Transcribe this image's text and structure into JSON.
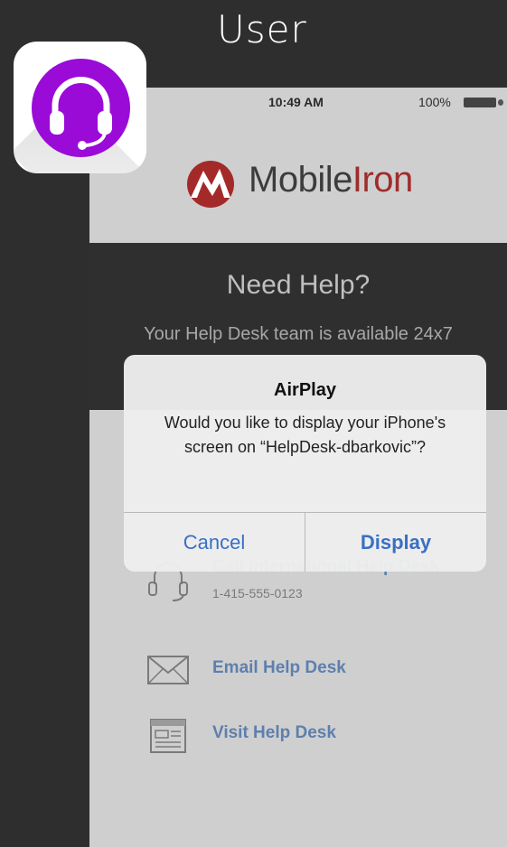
{
  "header": {
    "title": "User"
  },
  "app_icon": {
    "icon": "headset-icon",
    "color": "#9a0bd8"
  },
  "phone": {
    "status_bar": {
      "time": "10:49 AM",
      "battery": "100%"
    },
    "brand": {
      "name_part1": "Mobile",
      "name_part2": "Iron"
    },
    "help": {
      "title": "Need Help?",
      "subtitle": "Your Help Desk team is available 24x7"
    },
    "contacts": [
      {
        "label": "Call International Help Desk",
        "sub": "1-415-555-0123",
        "icon": "phone-icon"
      },
      {
        "label": "Email Help Desk",
        "icon": "envelope-icon"
      },
      {
        "label": "Visit Help Desk",
        "icon": "document-icon"
      }
    ]
  },
  "alert": {
    "title": "AirPlay",
    "message": "Would you like to display your iPhone's screen on “HelpDesk-dbarkovic”?",
    "cancel_label": "Cancel",
    "display_label": "Display"
  }
}
